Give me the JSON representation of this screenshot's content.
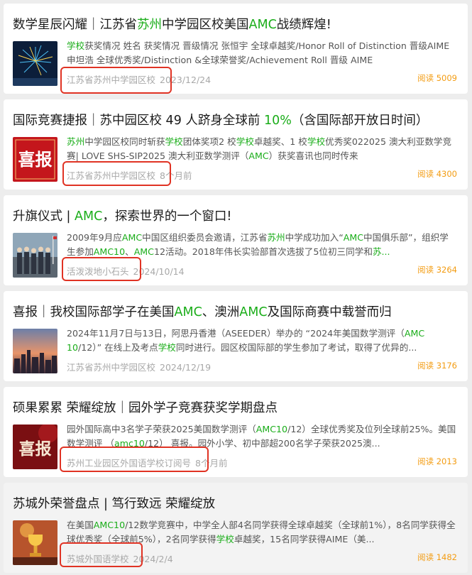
{
  "articles": [
    {
      "title": [
        "数学星辰闪耀｜江苏省",
        {
          "h": "苏州"
        },
        "中学园区校美国",
        {
          "h": "AMC"
        },
        "战绩辉煌!"
      ],
      "snippet": [
        {
          "h": "学校"
        },
        "获奖情况 姓名 获奖情况 晋级情况 张恒宇 全球卓越奖/Honor Roll of Distinction 晋级AIME 申坦浩 全球优秀奖/Distinction &全球荣誉奖/Achievement Roll 晋级 AIME"
      ],
      "source": "江苏省苏州中学园区校",
      "date": "2023/12/24",
      "reads": "阅读 5009",
      "thumb": "fireworks-thumbnail"
    },
    {
      "title": [
        "国际竞赛捷报｜苏中园区校 49 人跻身全球前 ",
        {
          "h": "10%"
        },
        "（含国际部开放日时间）"
      ],
      "snippet": [
        {
          "h": "苏州"
        },
        "中学园区校同时斩获",
        {
          "h": "学校"
        },
        "团体奖项2 校",
        {
          "h": "学校"
        },
        "卓越奖、1 校",
        {
          "h": "学校"
        },
        "优秀奖022025 澳大利亚数学竞赛| LOVE SHS-SIP2025 澳大利亚数学测评（",
        {
          "h": "AMC"
        },
        "）获奖喜讯也同时传来"
      ],
      "source": "江苏省苏州中学园区校",
      "date": "8个月前",
      "reads": "阅读 4300",
      "thumb": "xibao-red-thumbnail"
    },
    {
      "title": [
        "升旗仪式 | ",
        {
          "h": "AMC"
        },
        "，探索世界的一个窗口!"
      ],
      "snippet": [
        "2009年9月应",
        {
          "h": "AMC"
        },
        "中国区组织委员会邀请，江苏省",
        {
          "h": "苏州"
        },
        "中学成功加入“",
        {
          "h": "AMC"
        },
        "中国俱乐部”，组织学生参加",
        {
          "h": "AMC10"
        },
        "、",
        {
          "h": "AMC"
        },
        "12活动。2018年伟长实验部首次选拔了5位初三同学和",
        {
          "h": "苏..."
        }
      ],
      "source": "活泼泼地小石头",
      "date": "2024/10/14",
      "reads": "阅读 3264",
      "thumb": "flag-ceremony-thumbnail"
    },
    {
      "title": [
        "喜报｜我校国际部学子在美国",
        {
          "h": "AMC"
        },
        "、澳洲",
        {
          "h": "AMC"
        },
        "及国际商赛中载誉而归"
      ],
      "snippet": [
        "2024年11月7日与13日，阿思丹香港（ASEEDER）举办的 “2024年美国数学测评（",
        {
          "h": "AMC 10"
        },
        "/12）” 在线上及考点",
        {
          "h": "学校"
        },
        "同时进行。园区校国际部的学生参加了考试，取得了优异的..."
      ],
      "source": "江苏省苏州中学园区校",
      "date": "2024/12/19",
      "reads": "阅读 3176",
      "thumb": "city-sunset-thumbnail"
    },
    {
      "title": [
        "硕果累累 荣耀绽放｜园外学子竞赛获奖学期盘点"
      ],
      "snippet": [
        "园外国际高中3名学子荣获2025美国数学测评（",
        {
          "h": "AMC10"
        },
        "/12）全球优秀奖及位列全球前25%。美国数学测评 （",
        {
          "h": "amc10"
        },
        "/12） 喜报。园外小学、初中部超200名学子荣获2025澳..."
      ],
      "source": "苏州工业园区外国语学校订阅号",
      "date": "8个月前",
      "reads": "阅读 2013",
      "thumb": "xibao-dark-thumbnail"
    },
    {
      "title": [
        "苏城外荣誉盘点 | 笃行致远 荣耀绽放"
      ],
      "snippet": [
        "在美国",
        {
          "h": "AMC10"
        },
        "/12数学竞赛中，中学全人部4名同学获得全球卓越奖（全球前1%），8名同学获得全球优秀奖（全球前5%），2名同学获得",
        {
          "h": "学校"
        },
        "卓越奖，15名同学获得AIME（美..."
      ],
      "source": "苏城外国语学校",
      "date": "2024/2/4",
      "reads": "阅读 1482",
      "thumb": "trophy-thumbnail"
    }
  ]
}
